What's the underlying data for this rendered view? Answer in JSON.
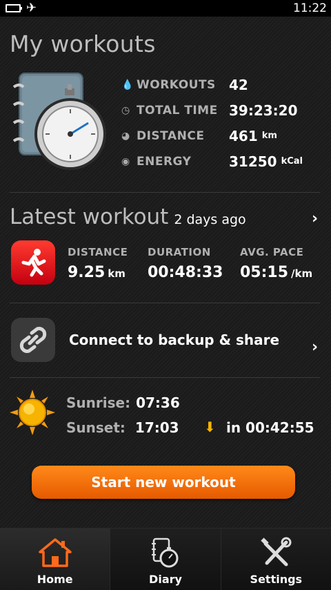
{
  "status_bar": {
    "time": "11:22",
    "icons": [
      "battery-icon",
      "airplane-mode-icon"
    ]
  },
  "page_title": "My workouts",
  "stats": [
    {
      "icon": "drop-icon",
      "label": "WORKOUTS",
      "value": "42",
      "unit": ""
    },
    {
      "icon": "clock-icon",
      "label": "TOTAL TIME",
      "value": "39:23:20",
      "unit": ""
    },
    {
      "icon": "distance-icon",
      "label": "DISTANCE",
      "value": "461",
      "unit": "km"
    },
    {
      "icon": "energy-icon",
      "label": "ENERGY",
      "value": "31250",
      "unit": "kCal"
    }
  ],
  "latest": {
    "title": "Latest workout",
    "when": "2 days ago",
    "distance_label": "DISTANCE",
    "distance_value": "9.25",
    "distance_unit": "km",
    "duration_label": "DURATION",
    "duration_value": "00:48:33",
    "pace_label": "AVG. PACE",
    "pace_value": "05:15",
    "pace_unit": "/km"
  },
  "connect": {
    "label": "Connect to backup & share"
  },
  "sun": {
    "sunrise_label": "Sunrise:",
    "sunrise_value": "07:36",
    "sunset_label": "Sunset:",
    "sunset_value": "17:03",
    "countdown": "in 00:42:55"
  },
  "start_button": "Start new workout",
  "tabs": [
    {
      "label": "Home",
      "icon": "home-icon",
      "active": true
    },
    {
      "label": "Diary",
      "icon": "diary-icon",
      "active": false
    },
    {
      "label": "Settings",
      "icon": "tools-icon",
      "active": false
    }
  ],
  "colors": {
    "accent": "#ff7a10",
    "run_icon": "#e8101c",
    "sun": "#f6b400"
  }
}
